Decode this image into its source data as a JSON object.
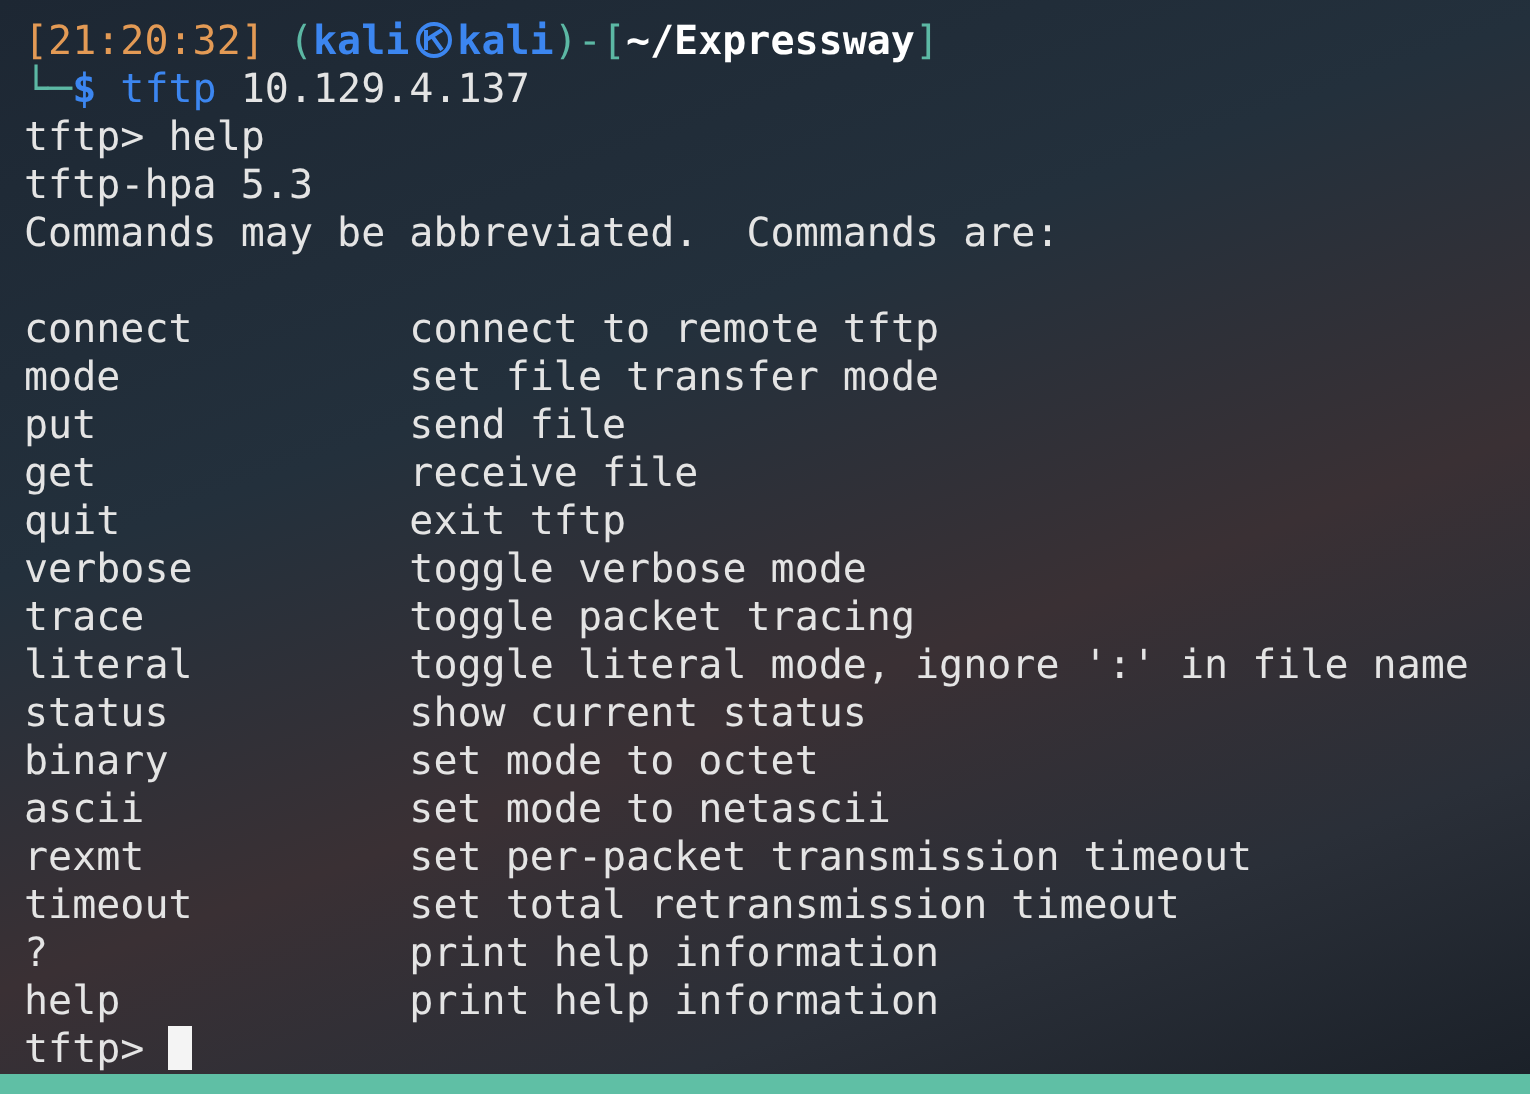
{
  "prompt": {
    "time": "[21:20:32]",
    "open": "(",
    "user": "kali",
    "host": "kali",
    "close": ")-[",
    "cwd": "~/Expressway",
    "end": "]"
  },
  "command_line": {
    "corner": "└─",
    "symbol": "$",
    "command": "tftp",
    "args": "10.129.4.137"
  },
  "output": [
    "tftp> help",
    "tftp-hpa 5.3",
    "Commands may be abbreviated.  Commands are:"
  ],
  "commands": [
    {
      "name": "connect",
      "description": "connect to remote tftp"
    },
    {
      "name": "mode",
      "description": "set file transfer mode"
    },
    {
      "name": "put",
      "description": "send file"
    },
    {
      "name": "get",
      "description": "receive file"
    },
    {
      "name": "quit",
      "description": "exit tftp"
    },
    {
      "name": "verbose",
      "description": "toggle verbose mode"
    },
    {
      "name": "trace",
      "description": "toggle packet tracing"
    },
    {
      "name": "literal",
      "description": "toggle literal mode, ignore ':' in file name"
    },
    {
      "name": "status",
      "description": "show current status"
    },
    {
      "name": "binary",
      "description": "set mode to octet"
    },
    {
      "name": "ascii",
      "description": "set mode to netascii"
    },
    {
      "name": "rexmt",
      "description": "set per-packet transmission timeout"
    },
    {
      "name": "timeout",
      "description": "set total retransmission timeout"
    },
    {
      "name": "?",
      "description": "print help information"
    },
    {
      "name": "help",
      "description": "print help information"
    }
  ],
  "input_prompt": "tftp>"
}
